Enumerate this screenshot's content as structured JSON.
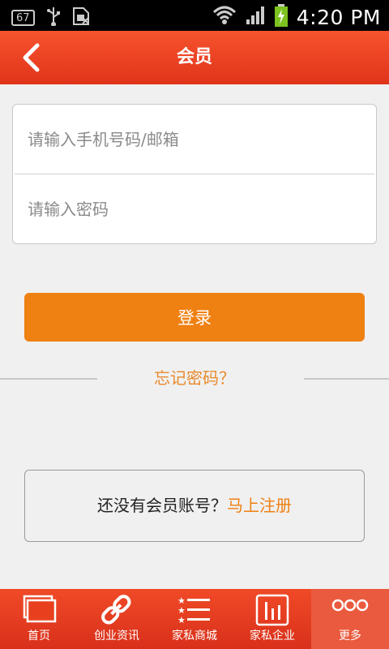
{
  "status_bar": {
    "badge": "67",
    "time": "4:20 PM",
    "icons": [
      "usb-icon",
      "sim-icon",
      "wifi-icon",
      "signal-icon",
      "battery-charging-icon"
    ]
  },
  "header": {
    "title": "会员",
    "back_icon": "chevron-left-icon"
  },
  "login_form": {
    "account_placeholder": "请输入手机号码/邮箱",
    "password_placeholder": "请输入密码",
    "login_label": "登录",
    "forgot_label": "忘记密码？"
  },
  "register": {
    "prompt": "还没有会员账号？",
    "link": "马上注册"
  },
  "bottom_nav": {
    "items": [
      {
        "label": "首页",
        "icon": "home-pages-icon"
      },
      {
        "label": "创业资讯",
        "icon": "link-icon"
      },
      {
        "label": "家私商城",
        "icon": "star-list-icon"
      },
      {
        "label": "家私企业",
        "icon": "chart-box-icon"
      },
      {
        "label": "更多",
        "icon": "more-dots-icon"
      }
    ]
  },
  "colors": {
    "header": "#e8401f",
    "accent": "#ef8012",
    "background": "#f0f0f0"
  }
}
